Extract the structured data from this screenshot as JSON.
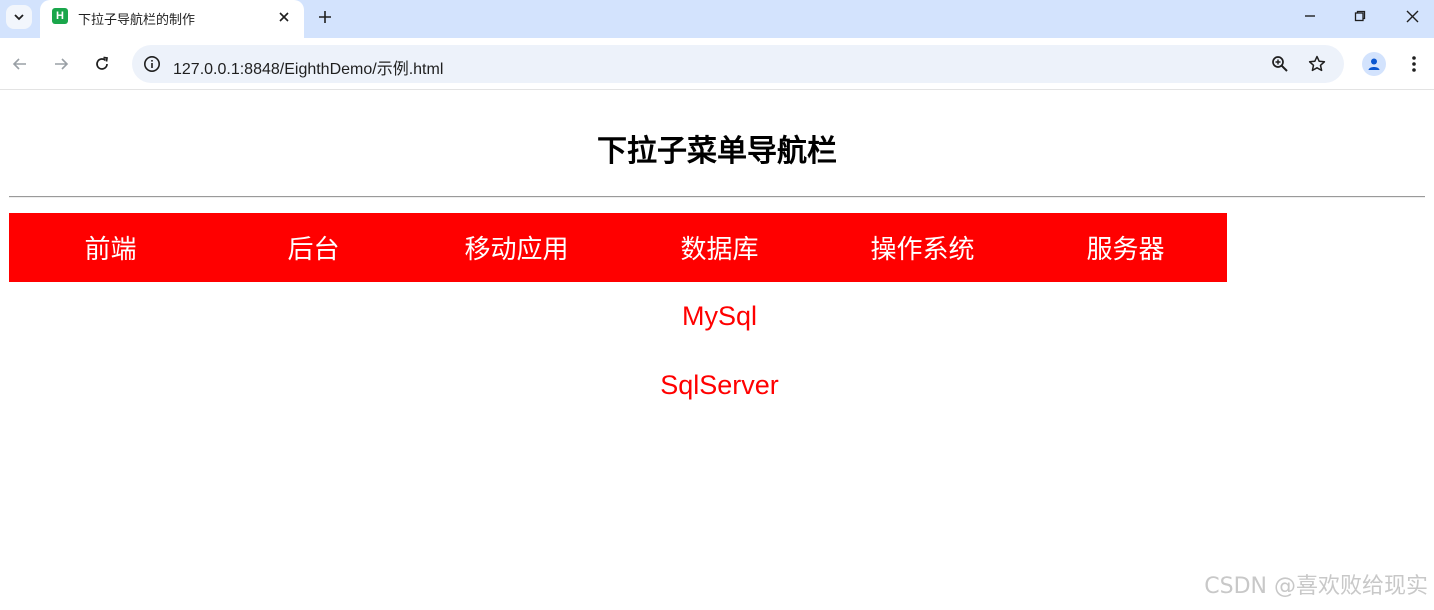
{
  "browser": {
    "tab_title": "下拉子导航栏的制作",
    "favicon_letter": "H",
    "url": "127.0.0.1:8848/EighthDemo/示例.html"
  },
  "page": {
    "title": "下拉子菜单导航栏",
    "nav_items": [
      "前端",
      "后台",
      "移动应用",
      "数据库",
      "操作系统",
      "服务器"
    ],
    "submenu_items": [
      "MySql",
      "SqlServer"
    ]
  },
  "watermark": "CSDN @喜欢败给现实",
  "colors": {
    "navbar_bg": "#ff0000",
    "nav_text": "#ffffff",
    "submenu_text": "#ff0000",
    "tabstrip_bg": "#d3e3fd"
  }
}
